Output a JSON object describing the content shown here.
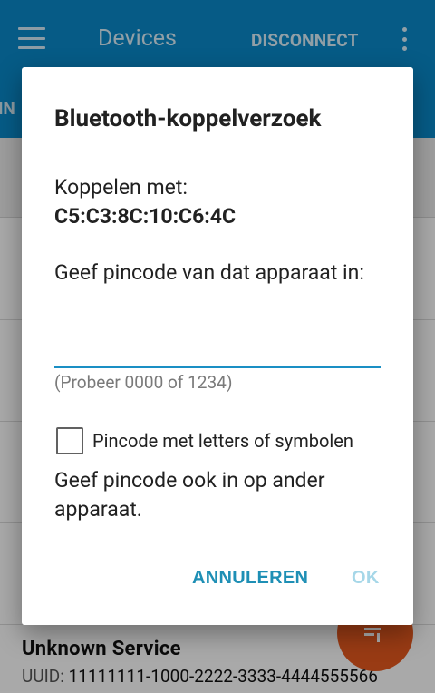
{
  "appbar": {
    "title": "Devices",
    "disconnect_label": "DISCONNECT",
    "partial_tab_label": "NN",
    "color": "#0a86c6"
  },
  "service": {
    "name": "Unknown Service",
    "uuid_label": "UUID:",
    "uuid_value": "11111111-1000-2222-3333-4444555566"
  },
  "fab": {
    "icon": "playlist-icon",
    "color": "#e2571e"
  },
  "dialog": {
    "title": "Bluetooth-koppelverzoek",
    "pair_label": "Koppelen met:",
    "mac": "C5:C3:8C:10:C6:4C",
    "prompt": "Geef pincode van dat apparaat in:",
    "pin_value": "",
    "hint": "(Probeer 0000 of 1234)",
    "checkbox_label": "Pincode met letters of symbolen",
    "checkbox_checked": false,
    "note": "Geef pincode ook in op ander apparaat.",
    "cancel_label": "ANNULEREN",
    "ok_label": "OK",
    "accent_color": "#1e8fb5"
  }
}
